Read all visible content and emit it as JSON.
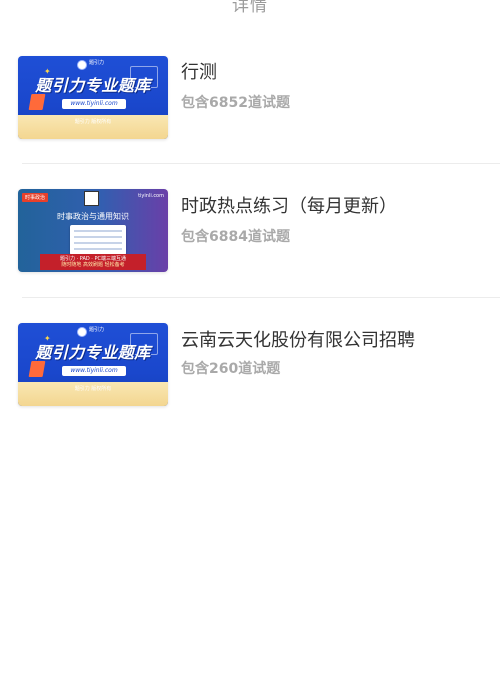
{
  "header": {
    "title": "详情"
  },
  "items": [
    {
      "name": "行测",
      "count_text": "包含6852道试题",
      "thumbnail": {
        "style": "brand-banner",
        "logo_text": "题引力",
        "headline": "题引力专业题库",
        "url": "www.tiyinli.com",
        "copyright": "题引力 版权所有"
      }
    },
    {
      "name": "时政热点练习（每月更新）",
      "count_text": "包含6884道试题",
      "thumbnail": {
        "style": "current-affairs-banner",
        "tag": "时事政治",
        "site": "tiyinli.com",
        "headline": "时事政治与通用知识",
        "band_line1": "题引力 · PAD · PC端三端互通",
        "band_line2": "随时随地 高效刷题 轻松备考"
      }
    },
    {
      "name": "云南云天化股份有限公司招聘",
      "count_text": "包含260道试题",
      "thumbnail": {
        "style": "brand-banner",
        "logo_text": "题引力",
        "headline": "题引力专业题库",
        "url": "www.tiyinli.com",
        "copyright": "题引力 版权所有"
      }
    }
  ],
  "colors": {
    "title": "#9b9b9b",
    "item_name": "#333333",
    "count": "#a9a9a9",
    "divider": "#ececec",
    "banner_blue": "#1a47cc"
  }
}
